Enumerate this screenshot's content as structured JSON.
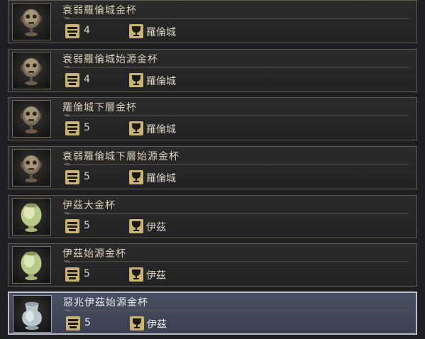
{
  "items": [
    {
      "name": "衰弱羅倫城金杯",
      "weight": "4",
      "location": "羅倫城",
      "chalice": "skull",
      "selected": false
    },
    {
      "name": "衰弱羅倫城始源金杯",
      "weight": "4",
      "location": "羅倫城",
      "chalice": "skull",
      "selected": false
    },
    {
      "name": "羅倫城下層金杯",
      "weight": "5",
      "location": "羅倫城",
      "chalice": "skull",
      "selected": false
    },
    {
      "name": "衰弱羅倫城下層始源金杯",
      "weight": "5",
      "location": "羅倫城",
      "chalice": "skull",
      "selected": false
    },
    {
      "name": "伊茲大金杯",
      "weight": "5",
      "location": "伊茲",
      "chalice": "jade-green",
      "selected": false
    },
    {
      "name": "伊茲始源金杯",
      "weight": "5",
      "location": "伊茲",
      "chalice": "jade-green",
      "selected": false
    },
    {
      "name": "惡兆伊茲始源金杯",
      "weight": "5",
      "location": "伊茲",
      "chalice": "pale-blue",
      "selected": true
    }
  ],
  "icons": {
    "weight": "weight-icon",
    "location": "chalice-location-icon"
  },
  "colors": {
    "accent_gold": "#c9b276",
    "selected_bg": "#3f4556",
    "selected_border": "#b9bccb"
  }
}
